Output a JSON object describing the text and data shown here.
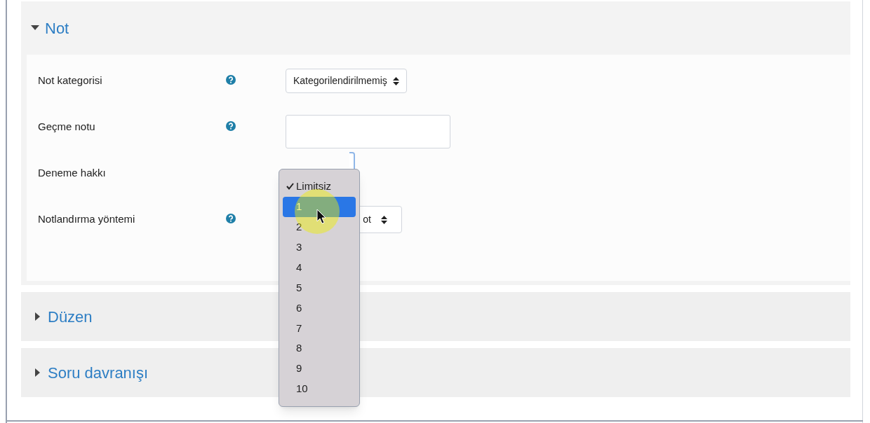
{
  "sections": [
    {
      "title": "Not",
      "expanded": true,
      "fields": [
        {
          "label": "Not kategorisi",
          "help": true,
          "kind": "select",
          "value": "Kategorilendirilmemiş"
        },
        {
          "label": "Geçme notu",
          "help": true,
          "kind": "text"
        },
        {
          "label": "Deneme hakkı",
          "help": false,
          "kind": "select-open"
        },
        {
          "label": "Notlandırma yöntemi",
          "help": true,
          "kind": "select-partial",
          "value": "ot"
        }
      ]
    },
    {
      "title": "Düzen",
      "expanded": false
    },
    {
      "title": "Soru davranışı",
      "expanded": false
    }
  ],
  "dropdown": {
    "options": [
      {
        "label": "Limitsiz",
        "checked": true,
        "highlighted": false
      },
      {
        "label": "1",
        "checked": false,
        "highlighted": true
      },
      {
        "label": "2",
        "checked": false,
        "highlighted": false
      },
      {
        "label": "3",
        "checked": false,
        "highlighted": false
      },
      {
        "label": "4",
        "checked": false,
        "highlighted": false
      },
      {
        "label": "5",
        "checked": false,
        "highlighted": false
      },
      {
        "label": "6",
        "checked": false,
        "highlighted": false
      },
      {
        "label": "7",
        "checked": false,
        "highlighted": false
      },
      {
        "label": "8",
        "checked": false,
        "highlighted": false
      },
      {
        "label": "9",
        "checked": false,
        "highlighted": false
      },
      {
        "label": "10",
        "checked": false,
        "highlighted": false
      }
    ]
  }
}
